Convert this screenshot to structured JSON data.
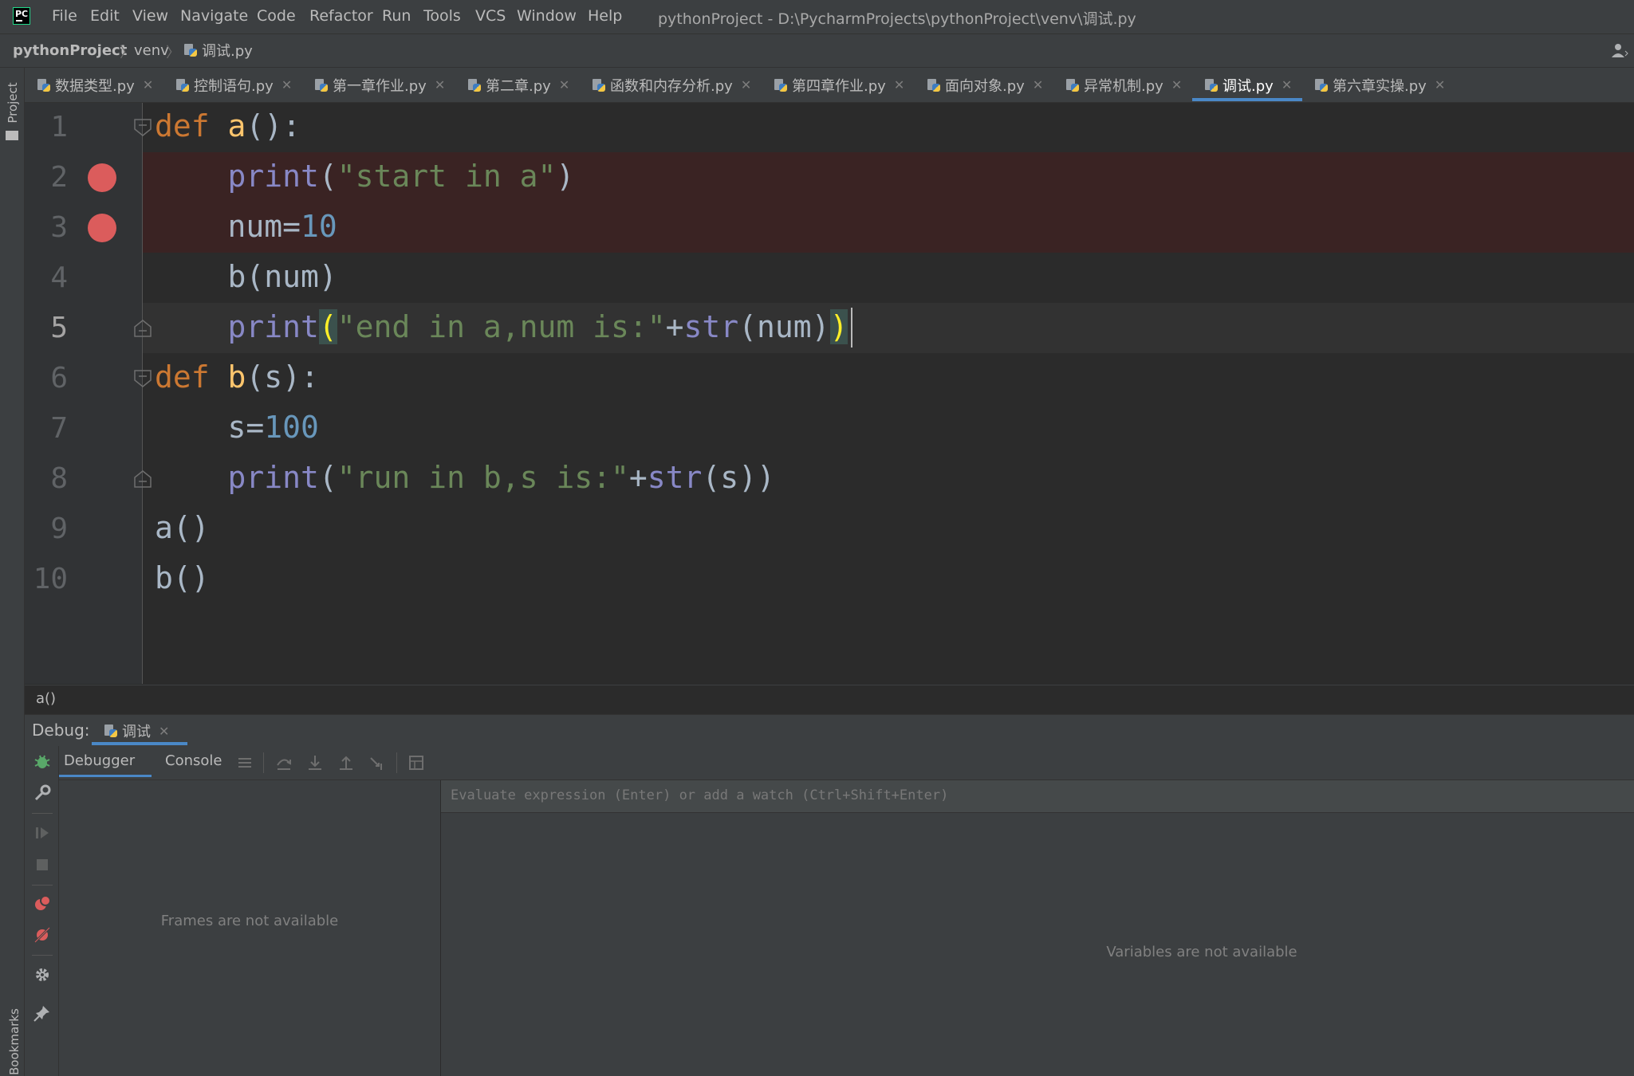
{
  "window": {
    "title": "pythonProject - D:\\PycharmProjects\\pythonProject\\venv\\调试.py"
  },
  "menu": [
    "File",
    "Edit",
    "View",
    "Navigate",
    "Code",
    "Refactor",
    "Run",
    "Tools",
    "VCS",
    "Window",
    "Help"
  ],
  "breadcrumb": [
    "pythonProject",
    "venv",
    "调试.py"
  ],
  "tool_windows": {
    "project": "Project",
    "bookmarks": "Bookmarks"
  },
  "tabs": [
    {
      "label": "数据类型.py"
    },
    {
      "label": "控制语句.py"
    },
    {
      "label": "第一章作业.py"
    },
    {
      "label": "第二章.py"
    },
    {
      "label": "函数和内存分析.py"
    },
    {
      "label": "第四章作业.py"
    },
    {
      "label": "面向对象.py"
    },
    {
      "label": "异常机制.py"
    },
    {
      "label": "调试.py",
      "active": true
    },
    {
      "label": "第六章实操.py"
    }
  ],
  "editor": {
    "line_numbers": [
      "1",
      "2",
      "3",
      "4",
      "5",
      "6",
      "7",
      "8",
      "9",
      "10"
    ],
    "current_line": 5,
    "breakpoint_lines": [
      2,
      3
    ],
    "lines": [
      [
        {
          "t": "def",
          "c": "kw"
        },
        {
          "t": " "
        },
        {
          "t": "a",
          "c": "fn"
        },
        {
          "t": "():"
        }
      ],
      [
        {
          "t": "    "
        },
        {
          "t": "print",
          "c": "bi"
        },
        {
          "t": "("
        },
        {
          "t": "\"start in a\"",
          "c": "str"
        },
        {
          "t": ")"
        }
      ],
      [
        {
          "t": "    num="
        },
        {
          "t": "10",
          "c": "num"
        }
      ],
      [
        {
          "t": "    b(num)"
        }
      ],
      [
        {
          "t": "    "
        },
        {
          "t": "print",
          "c": "bi"
        },
        {
          "t": "(",
          "c": "brk"
        },
        {
          "t": "\"end in a,num is:\"",
          "c": "str"
        },
        {
          "t": "+"
        },
        {
          "t": "str",
          "c": "bi"
        },
        {
          "t": "(num)"
        },
        {
          "t": ")",
          "c": "brk"
        }
      ],
      [
        {
          "t": "def",
          "c": "kw"
        },
        {
          "t": " "
        },
        {
          "t": "b",
          "c": "fn"
        },
        {
          "t": "(s):"
        }
      ],
      [
        {
          "t": "    s="
        },
        {
          "t": "100",
          "c": "num"
        }
      ],
      [
        {
          "t": "    "
        },
        {
          "t": "print",
          "c": "bi"
        },
        {
          "t": "("
        },
        {
          "t": "\"run in b,s is:\"",
          "c": "str"
        },
        {
          "t": "+"
        },
        {
          "t": "str",
          "c": "bi"
        },
        {
          "t": "(s))"
        }
      ],
      [
        {
          "t": "a()"
        }
      ],
      [
        {
          "t": "b()"
        }
      ]
    ],
    "scope_crumb": "a()"
  },
  "debug": {
    "label": "Debug:",
    "session_tab": "调试",
    "subtabs": {
      "debugger": "Debugger",
      "console": "Console"
    },
    "frames_empty": "Frames are not available",
    "eval_placeholder": "Evaluate expression (Enter) or add a watch (Ctrl+Shift+Enter)",
    "variables_empty": "Variables are not available"
  },
  "colors": {
    "accent": "#4a88c7",
    "breakpoint": "#db5c5c",
    "keyword": "#cc7832",
    "function": "#ffc66d",
    "builtin": "#8888c6",
    "string": "#6a8759",
    "number": "#6897bb"
  }
}
